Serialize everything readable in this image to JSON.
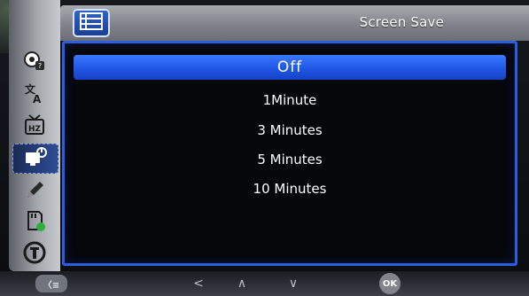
{
  "header": {
    "title": "Screen Save",
    "tab_icon": "list-menu-icon"
  },
  "sidebar": {
    "items": [
      {
        "icon": "settings-badge-icon",
        "active": false
      },
      {
        "icon": "language-icon",
        "active": false
      },
      {
        "icon": "tv-standard-icon",
        "active": false
      },
      {
        "icon": "display-power-icon",
        "active": true
      },
      {
        "icon": "pen-icon",
        "active": false
      },
      {
        "icon": "sd-card-icon",
        "active": false
      },
      {
        "icon": "info-icon",
        "active": false
      }
    ]
  },
  "menu": {
    "options": [
      "Off",
      "1Minute",
      "3 Minutes",
      "5 Minutes",
      "10 Minutes"
    ],
    "selected": "Off"
  },
  "footer": {
    "back_label": "〈≡",
    "left_label": "<",
    "up_label": "∧",
    "down_label": "∨",
    "ok_label": "OK"
  },
  "colors": {
    "accent": "#2b5fe0",
    "selected_fill": "#2a62f0",
    "header_gray": "#8a8e94"
  }
}
